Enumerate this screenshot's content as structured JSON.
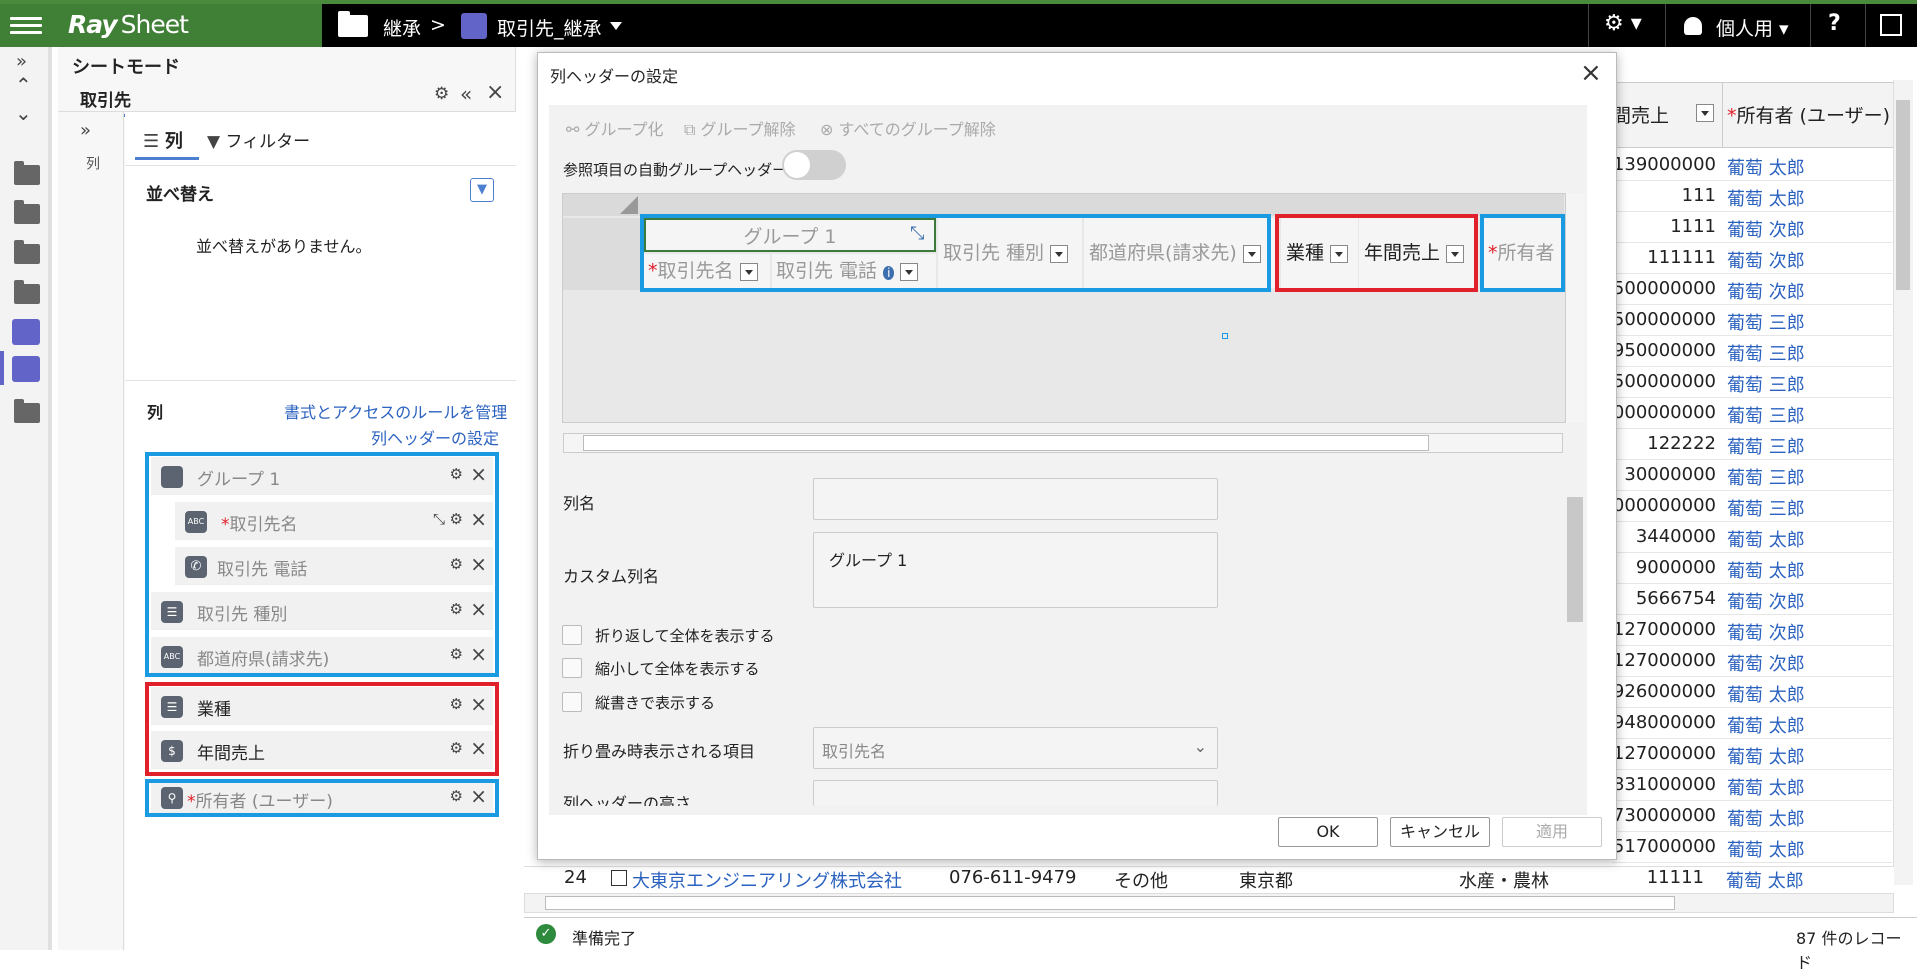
{
  "topbar": {
    "logo": "Ray",
    "logo_suffix": "Sheet",
    "breadcrumb_folder": "継承",
    "breadcrumb_sep": ">",
    "breadcrumb_sheet": "取引先_継承",
    "user_label": "個人用",
    "help": "?"
  },
  "panel": {
    "mode_title": "シートモード",
    "tab_name": "取引先",
    "subrail_label": "列",
    "tab_columns": "列",
    "tab_filter": "フィルター",
    "sort_title": "並べ替え",
    "sort_empty": "並べ替えがありません。",
    "columns_title": "列",
    "link_rules": "書式とアクセスのルールを管理",
    "link_header": "列ヘッダーの設定",
    "items": [
      {
        "label": "グループ 1"
      },
      {
        "label": "取引先名",
        "required": "*"
      },
      {
        "label": "取引先 電話"
      },
      {
        "label": "取引先 種別"
      },
      {
        "label": "都道府県(請求先)"
      },
      {
        "label": "業種"
      },
      {
        "label": "年間売上"
      },
      {
        "label": "所有者 (ユーザー)",
        "required": "*"
      }
    ]
  },
  "grid": {
    "col_sales": "間売上",
    "col_owner": "所有者 (ユーザー)",
    "col_owner_req": "*",
    "rows": [
      {
        "sales": "139000000",
        "owner": "葡萄 太郎"
      },
      {
        "sales": "111",
        "owner": "葡萄 太郎"
      },
      {
        "sales": "1111",
        "owner": "葡萄 次郎"
      },
      {
        "sales": "111111",
        "owner": "葡萄 次郎"
      },
      {
        "sales": "500000000",
        "owner": "葡萄 次郎"
      },
      {
        "sales": "500000000",
        "owner": "葡萄 三郎"
      },
      {
        "sales": "950000000",
        "owner": "葡萄 三郎"
      },
      {
        "sales": "500000000",
        "owner": "葡萄 三郎"
      },
      {
        "sales": "000000000",
        "owner": "葡萄 三郎"
      },
      {
        "sales": "122222",
        "owner": "葡萄 三郎"
      },
      {
        "sales": "30000000",
        "owner": "葡萄 三郎"
      },
      {
        "sales": "000000000",
        "owner": "葡萄 三郎"
      },
      {
        "sales": "3440000",
        "owner": "葡萄 太郎"
      },
      {
        "sales": "9000000",
        "owner": "葡萄 太郎"
      },
      {
        "sales": "5666754",
        "owner": "葡萄 次郎"
      },
      {
        "sales": "127000000",
        "owner": "葡萄 次郎"
      },
      {
        "sales": "127000000",
        "owner": "葡萄 次郎"
      },
      {
        "sales": "926000000",
        "owner": "葡萄 太郎"
      },
      {
        "sales": "948000000",
        "owner": "葡萄 太郎"
      },
      {
        "sales": "127000000",
        "owner": "葡萄 太郎"
      },
      {
        "sales": "831000000",
        "owner": "葡萄 太郎"
      },
      {
        "sales": "730000000",
        "owner": "葡萄 太郎"
      },
      {
        "sales": "517000000",
        "owner": "葡萄 太郎"
      }
    ],
    "last_row": {
      "num": "24",
      "name": "大東京エンジニアリング株式会社",
      "phone": "076-611-9479",
      "type": "その他",
      "pref": "東京都",
      "industry": "水産・農林",
      "sales": "11111",
      "owner": "葡萄 太郎"
    }
  },
  "dialog": {
    "title": "列ヘッダーの設定",
    "btn_group": "グループ化",
    "btn_ungroup": "グループ解除",
    "btn_ungroup_all": "すべてのグループ解除",
    "auto_group_label": "参照項目の自動グループヘッダー",
    "preview": {
      "group_label": "グループ 1",
      "col_name": "取引先名",
      "col_phone": "取引先 電話",
      "col_type": "取引先 種別",
      "col_pref": "都道府県(請求先)",
      "col_industry": "業種",
      "col_sales": "年間売上",
      "col_owner": "所有者",
      "req": "*"
    },
    "form": {
      "colname_label": "列名",
      "colname_value": "",
      "custom_label": "カスタム列名",
      "custom_value": "グループ 1",
      "wrap_label": "折り返して全体を表示する",
      "shrink_label": "縮小して全体を表示する",
      "vertical_label": "縦書きで表示する",
      "collapse_label": "折り畳み時表示される項目",
      "collapse_value": "取引先名",
      "height_label": "列ヘッダーの高さ"
    },
    "ok": "OK",
    "cancel": "キャンセル",
    "apply": "適用"
  },
  "status": {
    "ready": "準備完了",
    "count": "87 件のレコード"
  },
  "colors": {
    "accent_blue": "#1a9ae0",
    "accent_red": "#e0202a",
    "brand_green": "#3f7f36"
  }
}
